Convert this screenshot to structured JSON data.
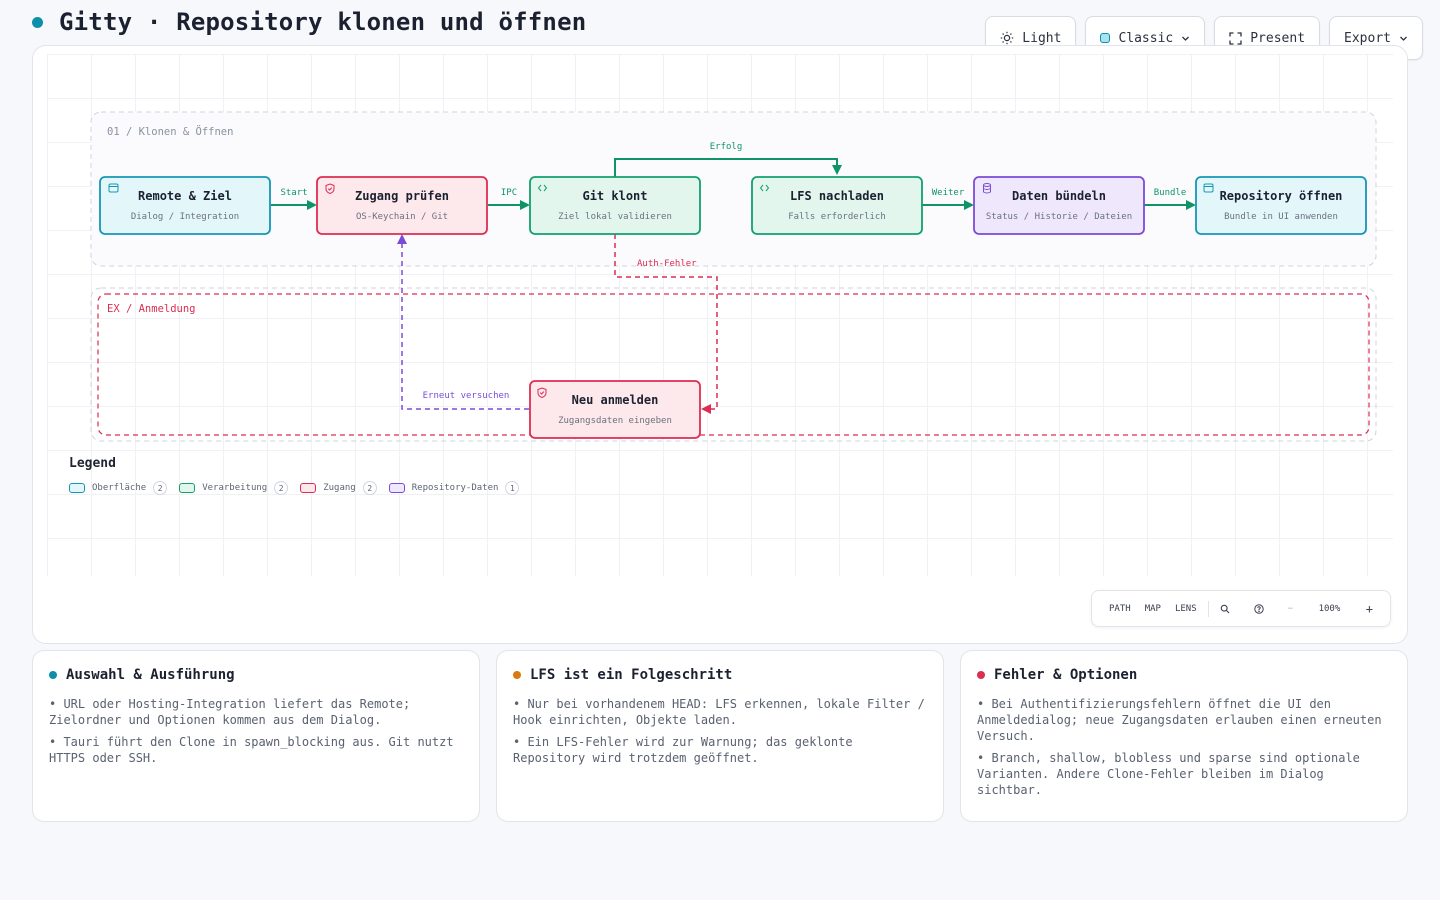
{
  "header": {
    "title": "Gitty · Repository klonen und öffnen",
    "accent": "#0e8fa9"
  },
  "toolbar": {
    "theme_label": "Light",
    "style_label": "Classic",
    "present_label": "Present",
    "export_label": "Export"
  },
  "diagram": {
    "groups": {
      "main": "01 / Klonen & Öffnen",
      "exception": "EX / Anmeldung"
    },
    "nodes": {
      "remote": {
        "title": "Remote & Ziel",
        "sub": "Dialog / Integration",
        "category": "Oberfläche"
      },
      "access": {
        "title": "Zugang prüfen",
        "sub": "OS-Keychain / Git",
        "category": "Zugang"
      },
      "clone": {
        "title": "Git klont",
        "sub": "Ziel lokal validieren",
        "category": "Verarbeitung"
      },
      "lfs": {
        "title": "LFS nachladen",
        "sub": "Falls erforderlich",
        "category": "Verarbeitung"
      },
      "bundle": {
        "title": "Daten bündeln",
        "sub": "Status / Historie / Dateien",
        "category": "Repository-Daten"
      },
      "open": {
        "title": "Repository öffnen",
        "sub": "Bundle in UI anwenden",
        "category": "Oberfläche"
      },
      "login": {
        "title": "Neu anmelden",
        "sub": "Zugangsdaten eingeben",
        "category": "Zugang"
      }
    },
    "edges": {
      "start": "Start",
      "ipc": "IPC",
      "success": "Erfolg",
      "next": "Weiter",
      "bundle": "Bundle",
      "auth_error": "Auth-Fehler",
      "retry": "Erneut versuchen"
    },
    "colors": {
      "ui": "#1497b5",
      "processing": "#12a06d",
      "access": "#dc2d52",
      "data": "#7b4bd8"
    }
  },
  "legend": {
    "title": "Legend",
    "items": [
      {
        "label": "Oberfläche",
        "count": "2",
        "color": "#1497b5"
      },
      {
        "label": "Verarbeitung",
        "count": "2",
        "color": "#12a06d"
      },
      {
        "label": "Zugang",
        "count": "2",
        "color": "#dc2d52"
      },
      {
        "label": "Repository-Daten",
        "count": "1",
        "color": "#7b4bd8"
      }
    ]
  },
  "zoombar": {
    "path": "PATH",
    "map": "MAP",
    "lens": "LENS",
    "zoom": "100%",
    "minus": "−",
    "plus": "+"
  },
  "cards": [
    {
      "title": "Auswahl & Ausführung",
      "color": "#0e8fa9",
      "bullets": [
        "• URL oder Hosting-Integration liefert das Remote; Zielordner und Optionen kommen aus dem Dialog.",
        "• Tauri führt den Clone in spawn_blocking aus. Git nutzt HTTPS oder SSH."
      ]
    },
    {
      "title": "LFS ist ein Folgeschritt",
      "color": "#d97a10",
      "bullets": [
        "• Nur bei vorhandenem HEAD: LFS erkennen, lokale Filter / Hook einrichten, Objekte laden.",
        "• Ein LFS-Fehler wird zur Warnung; das geklonte Repository wird trotzdem geöffnet."
      ]
    },
    {
      "title": "Fehler & Optionen",
      "color": "#dc2d52",
      "bullets": [
        "• Bei Authentifizierungsfehlern öffnet die UI den Anmeldedialog; neue Zugangsdaten erlauben einen erneuten Versuch.",
        "• Branch, shallow, blobless und sparse sind optionale Varianten. Andere Clone-Fehler bleiben im Dialog sichtbar."
      ]
    }
  ]
}
